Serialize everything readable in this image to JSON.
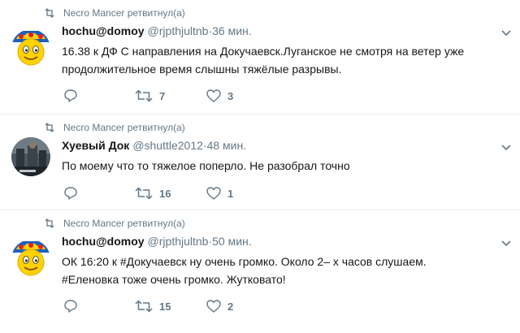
{
  "tweets": [
    {
      "retweet_text": "Necro Mancer ретвитнул(а)",
      "fullname": "hochu@domoy",
      "username": "@rjpthjultnb",
      "time": "·36 мин.",
      "text_lines": [
        "16.38 к ДФ С направления на Докучаевск.Луганское не смотря на ветер уже",
        "продолжительное время слышны тяжёлые разрывы."
      ],
      "retweets": "7",
      "likes": "3"
    },
    {
      "retweet_text": "Necro Mancer ретвитнул(а)",
      "fullname": "Хуевый Док",
      "username": "@shuttle2012",
      "time": "·48 мин.",
      "text_lines": [
        "По моему что то тяжелое поперло. Не разобрал точно"
      ],
      "retweets": "16",
      "likes": "1"
    },
    {
      "retweet_text": "Necro Mancer ретвитнул(а)",
      "fullname": "hochu@domoy",
      "username": "@rjpthjultnb",
      "time": "·50 мин.",
      "text_lines": [
        "ОК 16:20 к #Докучаевск ну очень громко. Около 2– х часов слушаем.",
        "#Еленовка тоже очень громко. Жутковато!"
      ],
      "retweets": "15",
      "likes": "2"
    }
  ],
  "icons": {
    "reply": "reply-icon",
    "retweet": "retweet-icon",
    "like": "heart-icon",
    "menu": "chevron-down-icon"
  },
  "colors": {
    "secondary_text": "#657786",
    "primary_text": "#14171a",
    "divider": "#e6ecf0"
  }
}
